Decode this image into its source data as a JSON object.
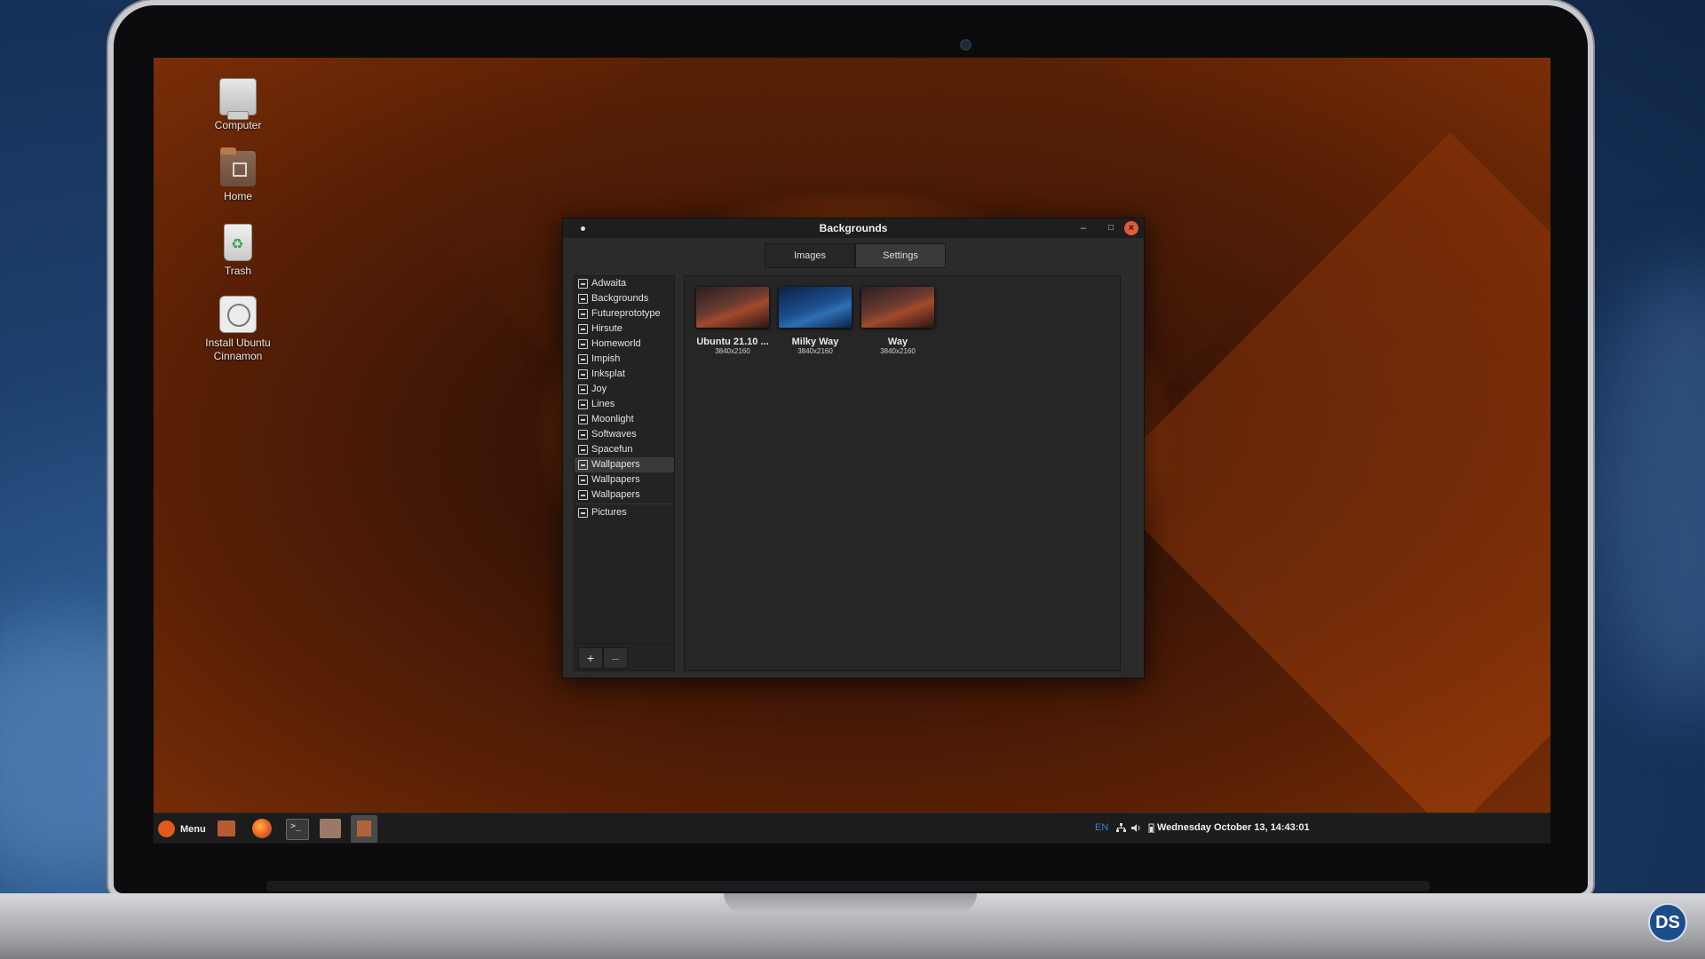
{
  "desktop": {
    "icons": [
      {
        "label": "Computer"
      },
      {
        "label": "Home"
      },
      {
        "label": "Trash"
      },
      {
        "label": "Install Ubuntu\nCinnamon"
      }
    ]
  },
  "window": {
    "title": "Backgrounds",
    "minimize": "–",
    "maximize": "□",
    "close": "×",
    "tabs": [
      "Images",
      "Settings"
    ],
    "active_tab": "Images",
    "sidebar": {
      "items": [
        "Adwaita",
        "Backgrounds",
        "Futureprototype",
        "Hirsute",
        "Homeworld",
        "Impish",
        "Inksplat",
        "Joy",
        "Lines",
        "Moonlight",
        "Softwaves",
        "Spacefun",
        "Wallpapers",
        "Wallpapers",
        "Wallpapers",
        "Pictures"
      ],
      "selected_index": 12,
      "add_label": "+",
      "remove_label": "–"
    },
    "thumbnails": [
      {
        "name": "Ubuntu 21.10 ...",
        "size": "3840x2160"
      },
      {
        "name": "Milky Way",
        "size": "3840x2160"
      },
      {
        "name": "Way",
        "size": "3840x2160"
      }
    ]
  },
  "panel": {
    "menu_label": "Menu",
    "keyboard_layout": "EN",
    "clock": "Wednesday October 13, 14:43:01"
  },
  "overlay": {
    "badge": "DS"
  },
  "colors": {
    "accent": "#e05a1c",
    "close_button": "#e25a3a",
    "keyboard_layout": "#3c7dd9"
  }
}
